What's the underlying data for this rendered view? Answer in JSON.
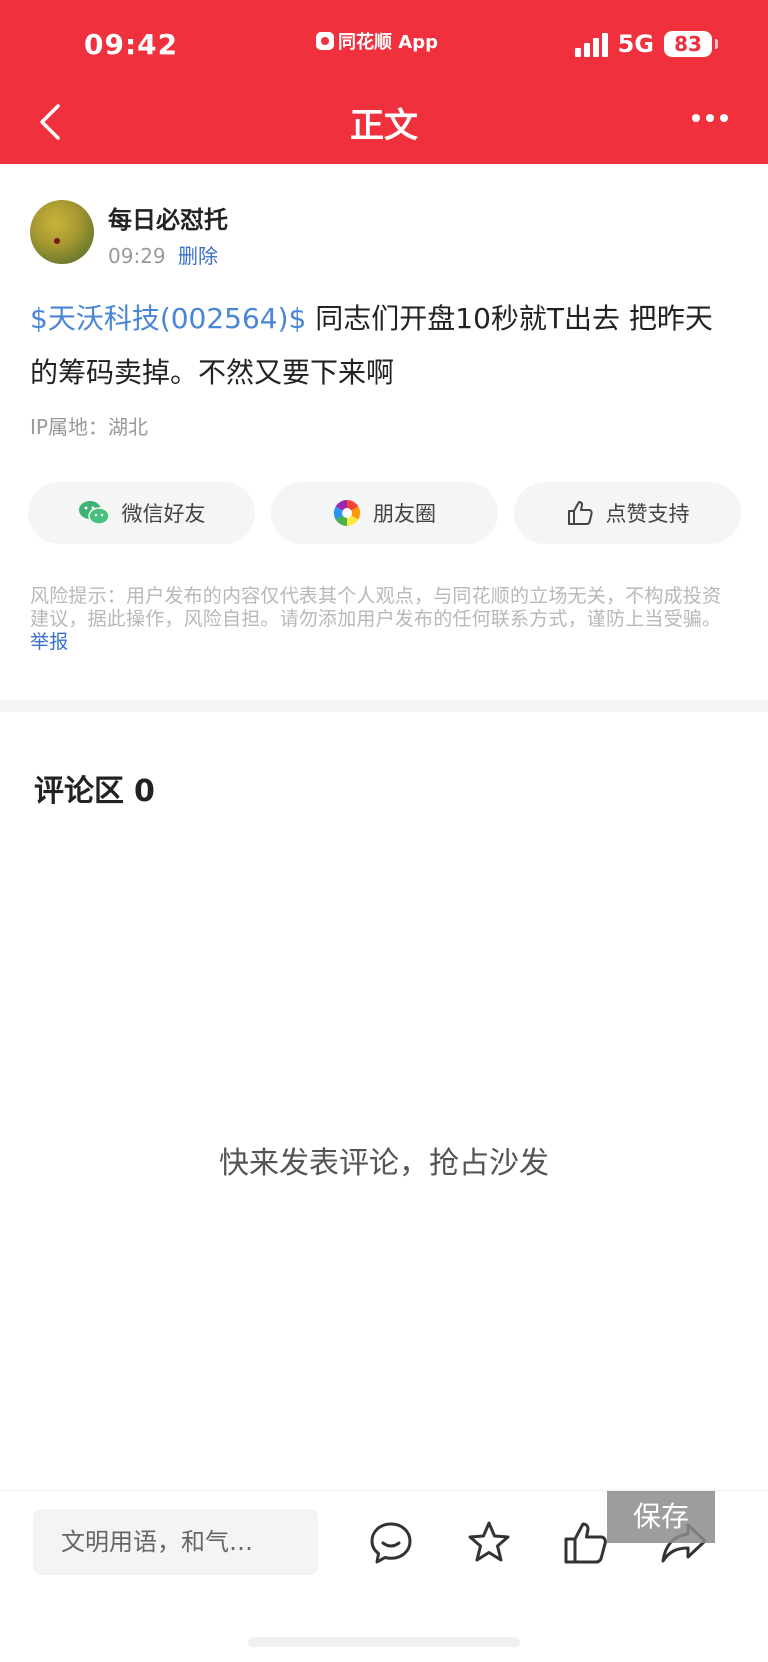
{
  "status_bar": {
    "time": "09:42",
    "app_name": "同花顺 App",
    "network": "5G",
    "battery": "83"
  },
  "nav": {
    "title": "正文"
  },
  "post": {
    "author": "每日必怼托",
    "time": "09:29",
    "delete_label": "删除",
    "stock_tag": "$天沃科技(002564)$",
    "body": " 同志们开盘10秒就T出去 把昨天的筹码卖掉。不然又要下来啊",
    "ip_location": "IP属地：湖北"
  },
  "share": {
    "wechat_label": "微信好友",
    "moments_label": "朋友圈",
    "like_label": "点赞支持"
  },
  "risk": {
    "text": "风险提示：用户发布的内容仅代表其个人观点，与同花顺的立场无关，不构成投资建议，据此操作，风险自担。请勿添加用户发布的任何联系方式，谨防上当受骗。",
    "report_label": "举报"
  },
  "comments": {
    "title": "评论区",
    "count": "0",
    "empty_text": "快来发表评论，抢占沙发"
  },
  "bottom_bar": {
    "input_placeholder": "文明用语，和气…",
    "save_overlay": "保存"
  },
  "colors": {
    "brand_red": "#f0303c",
    "link_blue": "#3a6fc8",
    "stock_blue": "#4a86d8"
  },
  "icons": [
    "back-icon",
    "more-icon",
    "wechat-icon",
    "moments-icon",
    "thumb-up-icon",
    "comment-icon",
    "star-icon",
    "share-icon"
  ]
}
